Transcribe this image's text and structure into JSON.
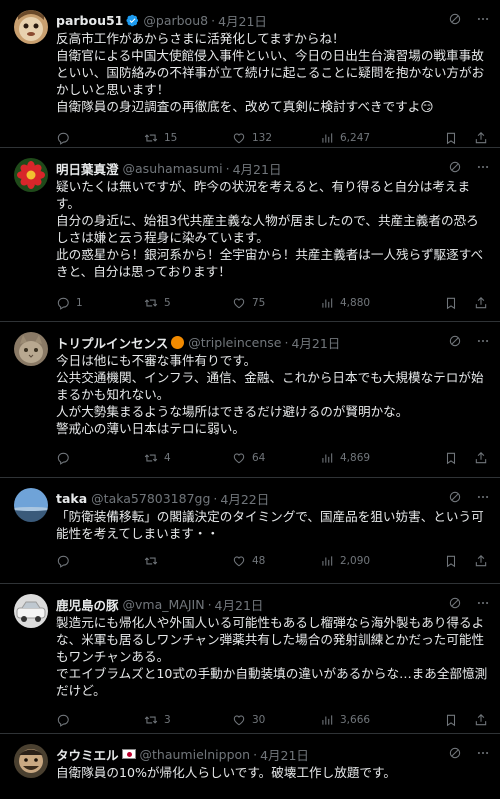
{
  "tweets": [
    {
      "name": "parbou51",
      "handle": "@parbou8",
      "time": "4月21日",
      "badge": "verified",
      "lines": [
        "反高市工作があからさまに活発化してますからね！",
        "自衛官による中国大使館侵入事件といい、今日の日出生台演習場の戦車事故といい、国防絡みの不祥事が立て続けに起こることに疑問を抱かない方がおかしいと思います！",
        "自衛隊員の身辺調査の再徹底を、改めて真剣に検討すべきですよ😏"
      ],
      "replies": "",
      "reposts": "15",
      "likes": "132",
      "views": "6,247"
    },
    {
      "name": "明日葉真澄",
      "handle": "@asuhamasumi",
      "time": "4月21日",
      "badge": "",
      "lines": [
        "疑いたくは無いですが、昨今の状況を考えると、有り得ると自分は考えます。",
        "自分の身近に、始祖3代共産主義な人物が居ましたので、共産主義者の恐ろしさは嫌と云う程身に染みています。",
        "此の惑星から！銀河系から！全宇宙から！共産主義者は一人残らず駆逐すべきと、自分は思っております！"
      ],
      "replies": "1",
      "reposts": "5",
      "likes": "75",
      "views": "4,880"
    },
    {
      "name": "トリプルインセンス",
      "handle": "@tripleincense",
      "time": "4月21日",
      "badge": "orange",
      "lines": [
        "今日は他にも不審な事件有りです。",
        "公共交通機関、インフラ、通信、金融、これから日本でも大規模なテロが始まるかも知れない。",
        "人が大勢集まるような場所はできるだけ避けるのが賢明かな。",
        "警戒心の薄い日本はテロに弱い。"
      ],
      "replies": "",
      "reposts": "4",
      "likes": "64",
      "views": "4,869"
    },
    {
      "name": "taka",
      "handle": "@taka57803187gg",
      "time": "4月22日",
      "badge": "",
      "lines": [
        "「防衛装備移転」の閣議決定のタイミングで、国産品を狙い妨害、という可能性を考えてしまいます・・"
      ],
      "replies": "",
      "reposts": "",
      "likes": "48",
      "views": "2,090"
    },
    {
      "name": "鹿児島の豚",
      "handle": "@vma_MAJIN",
      "time": "4月21日",
      "badge": "",
      "lines": [
        "製造元にも帰化人や外国人いる可能性もあるし榴弾なら海外製もあり得るよな、米軍も居るしワンチャン弾薬共有した場合の発射訓練とかだった可能性もワンチャンある。",
        "でエイブラムズと10式の手動か自動装填の違いがあるからな…まあ全部憶測だけど。"
      ],
      "replies": "",
      "reposts": "3",
      "likes": "30",
      "views": "3,666"
    },
    {
      "name": "タウミエル",
      "handle": "@thaumielnippon",
      "time": "4月21日",
      "badge": "flag",
      "lines": [
        "自衛隊員の10%が帰化人らしいです。破壊工作し放題です。"
      ],
      "replies": "",
      "reposts": "",
      "likes": "",
      "views": ""
    }
  ],
  "colors": {
    "background": "#000000",
    "text": "#e7e9ea",
    "muted": "#71767b",
    "border": "#2f3336",
    "verified": "#1d9bf0"
  }
}
